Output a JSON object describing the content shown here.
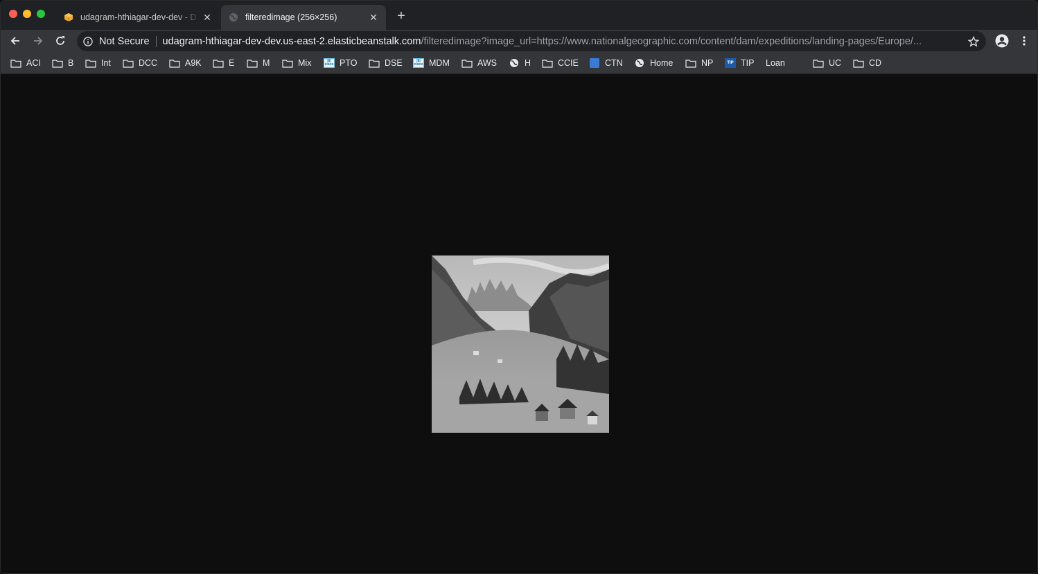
{
  "tabs": [
    {
      "title": "udagram-hthiagar-dev-dev - D",
      "favicon": "aws-box-icon",
      "active": false
    },
    {
      "title": "filteredimage (256×256)",
      "favicon": "globe-icon",
      "active": true
    }
  ],
  "new_tab_label": "+",
  "toolbar": {
    "security_label": "Not Secure",
    "url_host": "udagram-hthiagar-dev-dev.us-east-2.elasticbeanstalk.com",
    "url_path": "/filteredimage?image_url=https://www.nationalgeographic.com/content/dam/expeditions/landing-pages/Europe/..."
  },
  "bookmarks": [
    {
      "label": "ACI",
      "icon": "folder-icon"
    },
    {
      "label": "B",
      "icon": "folder-icon"
    },
    {
      "label": "Int",
      "icon": "folder-icon"
    },
    {
      "label": "DCC",
      "icon": "folder-icon"
    },
    {
      "label": "A9K",
      "icon": "folder-icon"
    },
    {
      "label": "E",
      "icon": "folder-icon"
    },
    {
      "label": "M",
      "icon": "folder-icon"
    },
    {
      "label": "Mix",
      "icon": "folder-icon"
    },
    {
      "label": "PTO",
      "icon": "cisco-icon"
    },
    {
      "label": "DSE",
      "icon": "folder-icon"
    },
    {
      "label": "MDM",
      "icon": "cisco-icon"
    },
    {
      "label": "AWS",
      "icon": "folder-icon"
    },
    {
      "label": "H",
      "icon": "globe-icon"
    },
    {
      "label": "CCIE",
      "icon": "folder-icon"
    },
    {
      "label": "CTN",
      "icon": "ctn-icon"
    },
    {
      "label": "Home",
      "icon": "globe-icon"
    },
    {
      "label": "NP",
      "icon": "folder-icon"
    },
    {
      "label": "TIP",
      "icon": "tip-icon"
    },
    {
      "label": "Loan",
      "icon": "none"
    },
    {
      "label": "UC",
      "icon": "folder-icon"
    },
    {
      "label": "CD",
      "icon": "folder-icon"
    }
  ],
  "icon_texts": {
    "cisco": "cisco",
    "tip": "TIP"
  },
  "content": {
    "image_alt": "grayscale mountain valley village"
  },
  "colors": {
    "tabstrip": "#202124",
    "toolbar": "#35363a",
    "page_bg": "#0e0e0e"
  }
}
